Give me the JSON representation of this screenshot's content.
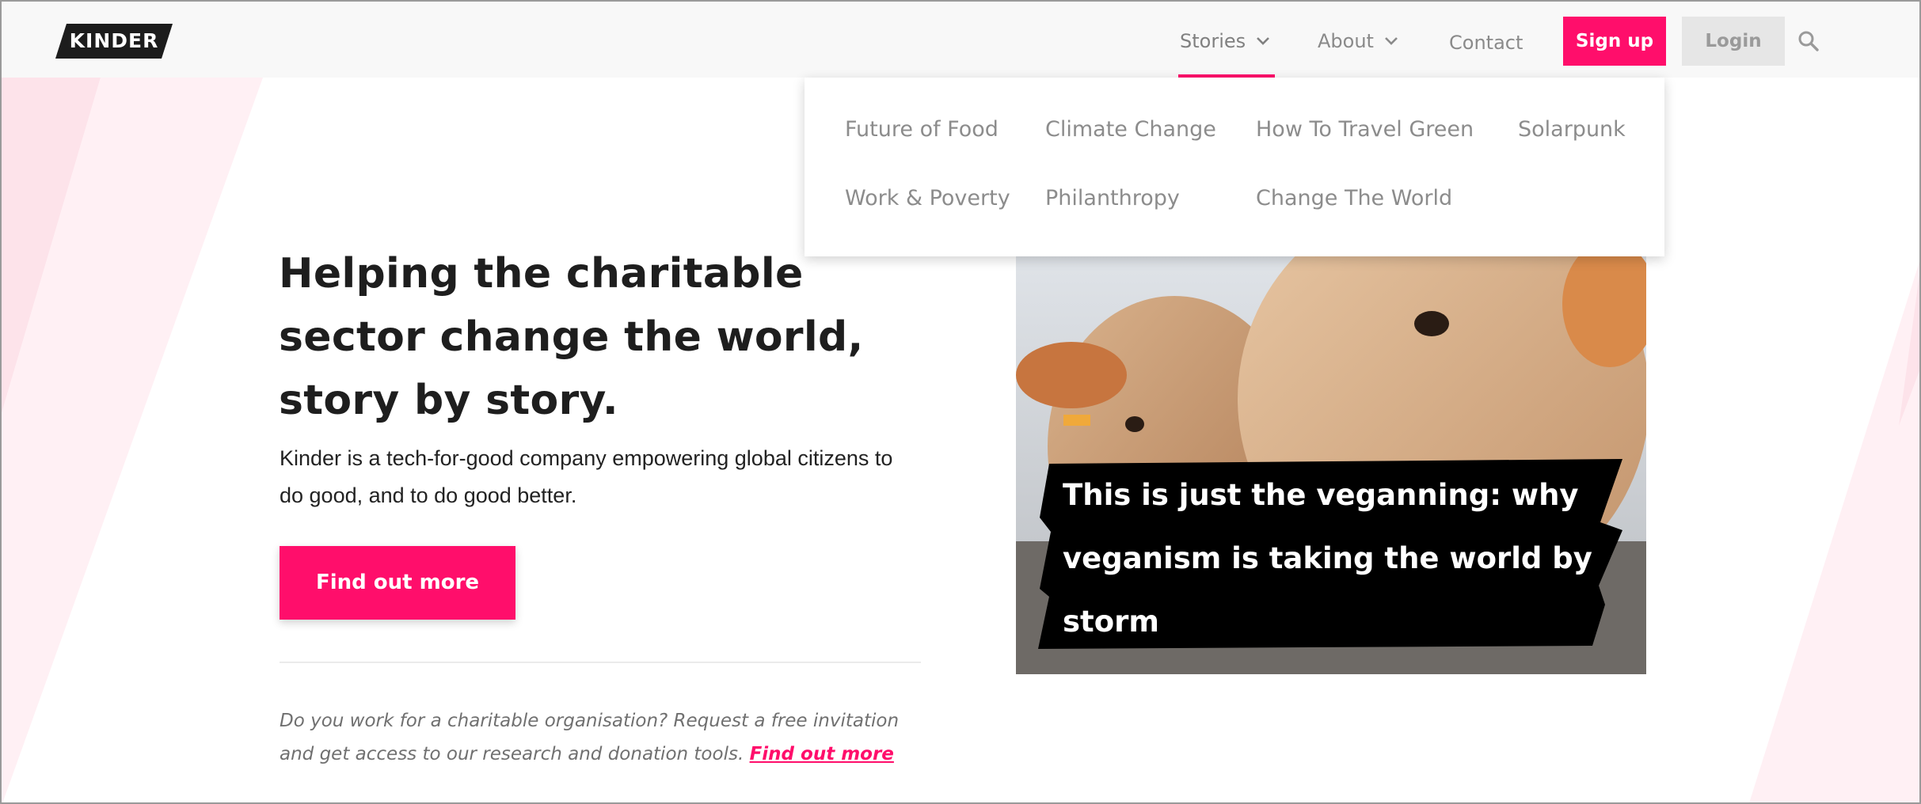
{
  "brand": {
    "logo_text": "KINDER",
    "accent_color": "#ff0e6b"
  },
  "nav": {
    "stories_label": "Stories",
    "about_label": "About",
    "contact_label": "Contact",
    "signup_label": "Sign up",
    "login_label": "Login",
    "search_icon": "search-icon"
  },
  "stories_menu": {
    "items": [
      "Future of Food",
      "Climate Change",
      "How To Travel Green",
      "Solarpunk",
      "Work & Poverty",
      "Philanthropy",
      "Change The World"
    ]
  },
  "hero": {
    "headline": "Helping the charitable sector change the world, story by story.",
    "subtitle": "Kinder is a tech-for-good company empowering global citizens to do good, and to do good better.",
    "cta_label": "Find out more",
    "invite_text": "Do you work for a charitable organisation? Request a free invitation and get access to our research and donation tools.",
    "invite_link": "Find out more"
  },
  "feature": {
    "caption": "This is just the veganning: why veganism is taking the world by storm"
  }
}
